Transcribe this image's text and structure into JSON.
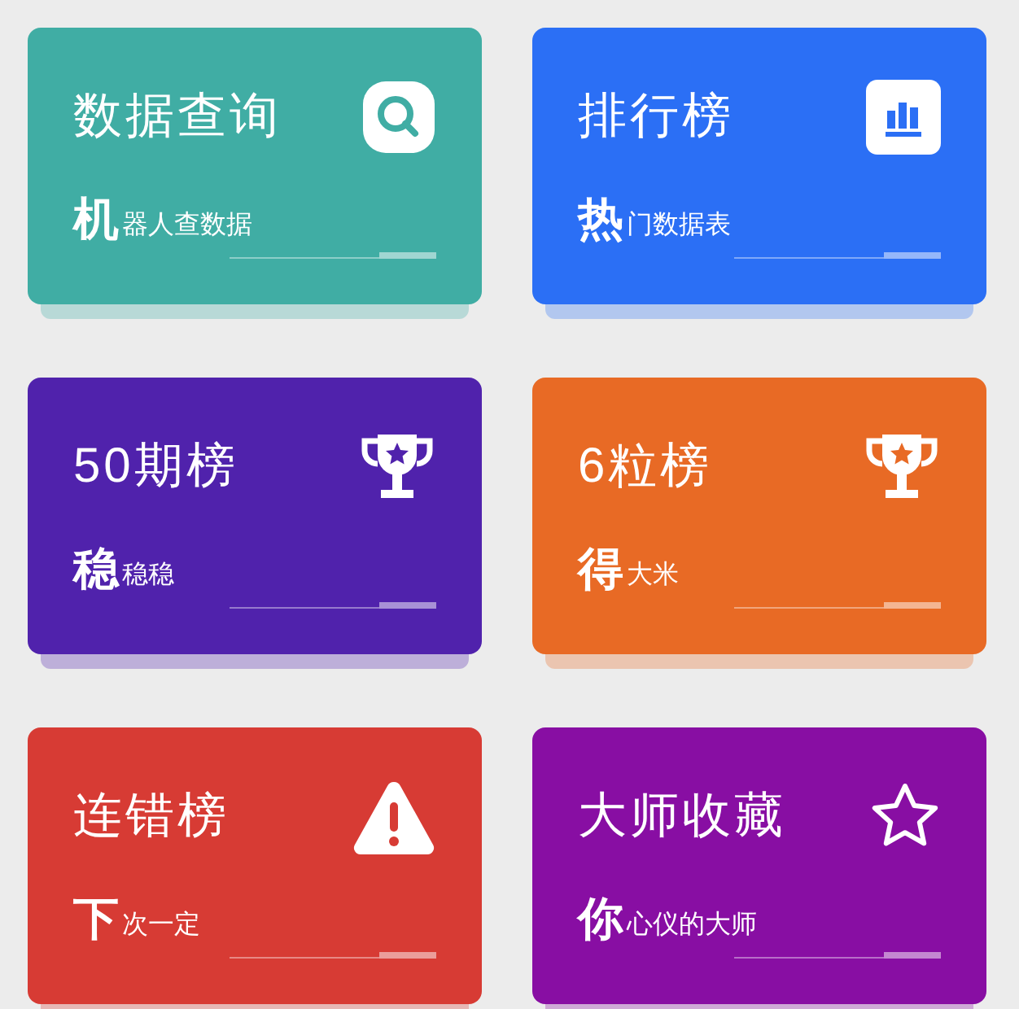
{
  "cards": [
    {
      "title": "数据查询",
      "lead": "机",
      "rest": "器人查数据",
      "kind": "search",
      "color": "#40ada4"
    },
    {
      "title": "排行榜",
      "lead": "热",
      "rest": "门数据表",
      "kind": "chart",
      "color": "#2b6ff5"
    },
    {
      "title": "50期榜",
      "lead": "稳",
      "rest": "稳稳",
      "kind": "trophy",
      "color": "#5022ac"
    },
    {
      "title": "6粒榜",
      "lead": "得",
      "rest": "大米",
      "kind": "trophy",
      "color": "#e86a25"
    },
    {
      "title": "连错榜",
      "lead": "下",
      "rest": "次一定",
      "kind": "alert",
      "color": "#d73b34"
    },
    {
      "title": "大师收藏",
      "lead": "你",
      "rest": "心仪的大师",
      "kind": "star",
      "color": "#880ea3"
    }
  ]
}
